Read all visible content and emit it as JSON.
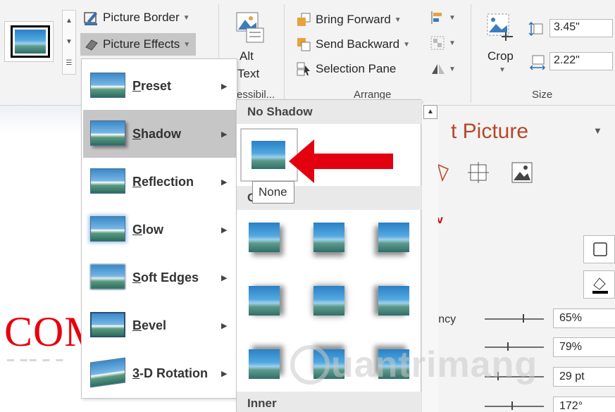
{
  "ribbon": {
    "picture_border": "Picture Border",
    "picture_effects": "Picture Effects",
    "alt_text_line1": "Alt",
    "alt_text_line2": "Text",
    "accessibility_label": "essibil...",
    "bring_forward": "Bring Forward",
    "send_backward": "Send Backward",
    "selection_pane": "Selection Pane",
    "arrange_label": "Arrange",
    "crop": "Crop",
    "height": "3.45\"",
    "width": "2.22\"",
    "size_label": "Size"
  },
  "picture_effects_menu": {
    "items": [
      {
        "label": "Preset"
      },
      {
        "label": "Shadow"
      },
      {
        "label": "Reflection"
      },
      {
        "label": "Glow"
      },
      {
        "label": "Soft Edges"
      },
      {
        "label": "Bevel"
      },
      {
        "label": "3-D Rotation"
      }
    ],
    "active": "Shadow"
  },
  "shadow_submenu": {
    "no_shadow_header": "No Shadow",
    "outer_header_partial": "C",
    "tooltip": "None",
    "inner_header": "Inner"
  },
  "document": {
    "visible_text": "COM"
  },
  "task_pane": {
    "title_partial": "t Picture",
    "section_marker": "v",
    "transparency_label": "rency",
    "values": [
      "65%",
      "79%",
      "29 pt",
      "172°"
    ]
  },
  "watermark": "uantrimang",
  "colors": {
    "arrow_red": "#e3000f",
    "pane_title": "#b7472a",
    "doc_text": "#e8000b",
    "menu_active_bg": "#c6c6c6"
  }
}
